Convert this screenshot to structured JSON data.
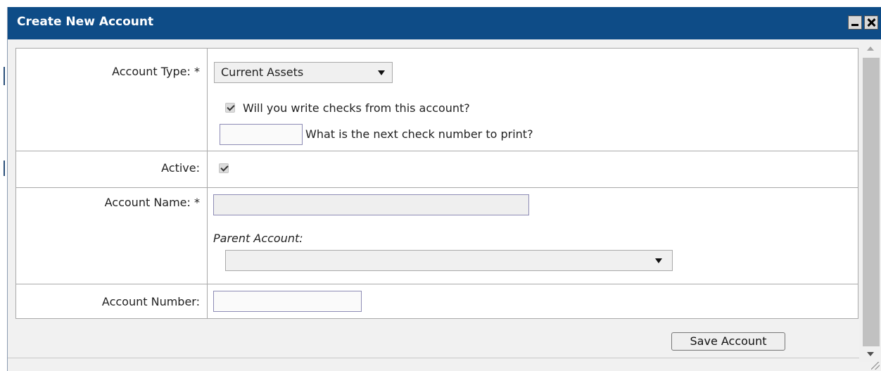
{
  "dialog": {
    "title": "Create New Account"
  },
  "form": {
    "account_type": {
      "label": "Account Type: *",
      "selected": "Current Assets",
      "write_checks_checked": true,
      "write_checks_label": "Will you write checks from this account?",
      "next_check_value": "",
      "next_check_label": "What is the next check number to print?"
    },
    "active": {
      "label": "Active:",
      "checked": true
    },
    "account_name": {
      "label": "Account Name: *",
      "value": "",
      "parent_label": "Parent Account:",
      "parent_selected": ""
    },
    "account_number": {
      "label": "Account Number:",
      "value": ""
    }
  },
  "actions": {
    "save_label": "Save Account"
  },
  "colors": {
    "titlebar": "#0e4c87",
    "field_border": "#8d8bb5"
  }
}
